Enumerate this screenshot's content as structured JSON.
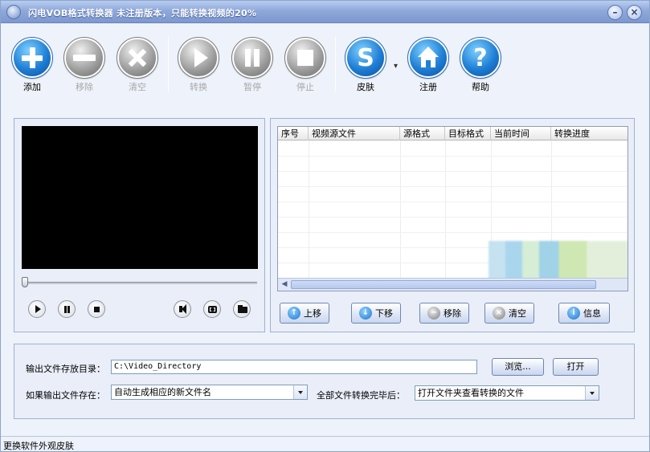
{
  "window": {
    "title": "闪电VOB格式转换器  未注册版本，只能转换视频的20%"
  },
  "toolbar": {
    "add": "添加",
    "remove": "移除",
    "clear": "清空",
    "convert": "转换",
    "pause": "暂停",
    "stop": "停止",
    "skin": "皮肤",
    "register": "注册",
    "help": "帮助"
  },
  "table": {
    "columns": [
      "序号",
      "视频源文件",
      "源格式",
      "目标格式",
      "当前时间",
      "转换进度"
    ],
    "rows": []
  },
  "list_buttons": {
    "up": "上移",
    "down": "下移",
    "remove": "移除",
    "clear": "清空",
    "info": "信息"
  },
  "output": {
    "dir_label": "输出文件存放目录：",
    "dir_value": "C:\\Video_Directory",
    "browse": "浏览...",
    "open": "打开",
    "exists_label": "如果输出文件存在：",
    "exists_value": "自动生成相应的新文件名",
    "after_label": "全部文件转换完毕后：",
    "after_value": "打开文件夹查看转换的文件"
  },
  "status": {
    "text": "更换软件外观皮肤"
  },
  "colors": {
    "accent": "#1f7fd6",
    "titlebar": "#8fa9da",
    "disabled": "#9a9a9a"
  }
}
